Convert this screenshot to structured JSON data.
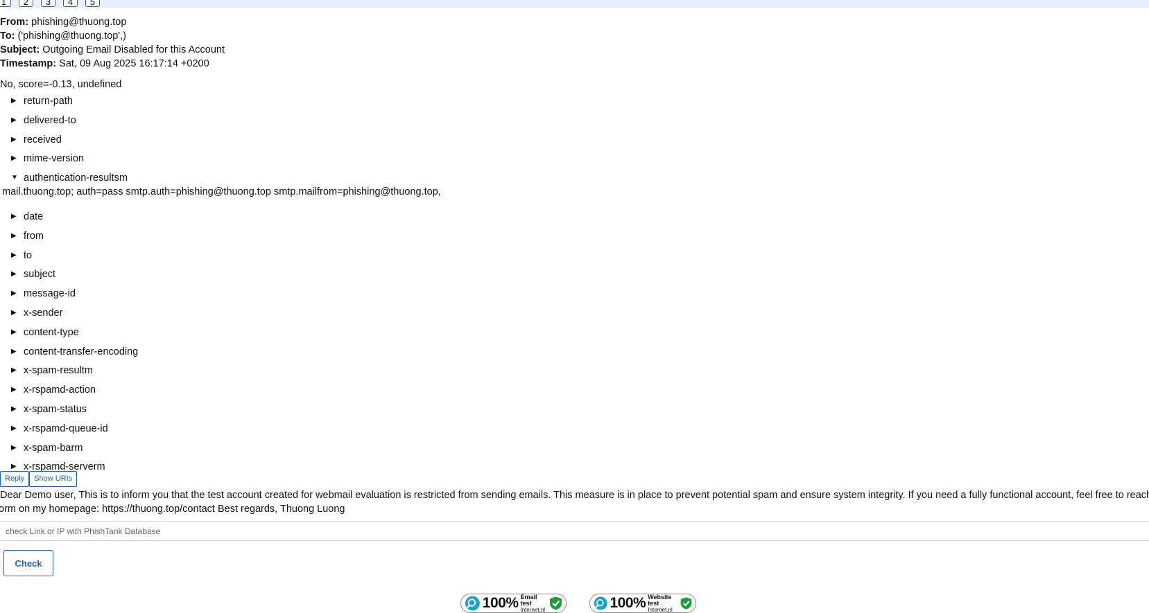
{
  "pagination": [
    "1",
    "2",
    "3",
    "4",
    "5"
  ],
  "email": {
    "from_label": "From:",
    "from": "phishing@thuong.top",
    "to_label": "To:",
    "to": "('phishing@thuong.top',)",
    "subject_label": "Subject:",
    "subject": "Outgoing Email Disabled for this Account",
    "timestamp_label": "Timestamp:",
    "timestamp": "Sat, 09 Aug 2025 16:17:14 +0200"
  },
  "spam_result": "No, score=-0.13, undefined",
  "headers": [
    {
      "name": "return-path",
      "expanded": false
    },
    {
      "name": "delivered-to",
      "expanded": false
    },
    {
      "name": "received",
      "expanded": false
    },
    {
      "name": "mime-version",
      "expanded": false
    },
    {
      "name": "authentication-resultsm",
      "expanded": true,
      "value": "mail.thuong.top; auth=pass smtp.auth=phishing@thuong.top smtp.mailfrom=phishing@thuong.top,"
    },
    {
      "name": "date",
      "expanded": false
    },
    {
      "name": "from",
      "expanded": false
    },
    {
      "name": "to",
      "expanded": false
    },
    {
      "name": "subject",
      "expanded": false
    },
    {
      "name": "message-id",
      "expanded": false
    },
    {
      "name": "x-sender",
      "expanded": false
    },
    {
      "name": "content-type",
      "expanded": false
    },
    {
      "name": "content-transfer-encoding",
      "expanded": false
    },
    {
      "name": "x-spam-resultm",
      "expanded": false
    },
    {
      "name": "x-rspamd-action",
      "expanded": false
    },
    {
      "name": "x-spam-status",
      "expanded": false
    },
    {
      "name": "x-rspamd-queue-id",
      "expanded": false
    },
    {
      "name": "x-spam-barm",
      "expanded": false
    },
    {
      "name": "x-rspamd-serverm",
      "expanded": false
    }
  ],
  "buttons": {
    "reply": "Reply",
    "show_uris": "Show URIs",
    "check": "Check"
  },
  "body": {
    "line1": "Dear Demo user, This is to inform you that the test account created for webmail evaluation is restricted from sending emails. This measure is in place to prevent potential spam and ensure system integrity. If you need a fully functional account, feel free to reach out via the contact",
    "line2": "orm on my homepage: https://thuong.top/contact Best regards, Thuong Luong"
  },
  "phishtank": {
    "placeholder": "check Link or IP with PhishTank Database"
  },
  "badges": [
    {
      "percent": "100%",
      "title": "Email test",
      "site": "Internet.nl"
    },
    {
      "percent": "100%",
      "title": "Website test",
      "site": "Internet.nl"
    }
  ],
  "colors": {
    "accent": "#1f5fb8",
    "badge_check": "#1a9e3a",
    "badge_logo": "#1aa3c9"
  }
}
